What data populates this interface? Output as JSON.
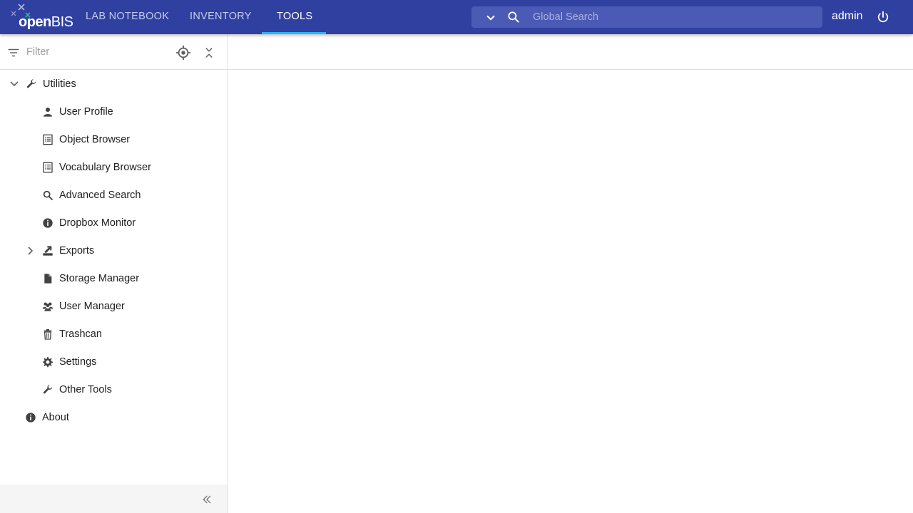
{
  "app": {
    "logo_text_light": "open",
    "logo_text_bold": "BIS"
  },
  "nav": {
    "tabs": [
      {
        "label": "LAB NOTEBOOK",
        "active": false
      },
      {
        "label": "INVENTORY",
        "active": false
      },
      {
        "label": "TOOLS",
        "active": true
      }
    ]
  },
  "search": {
    "placeholder": "Global Search",
    "value": ""
  },
  "user": {
    "name": "admin"
  },
  "sidebar": {
    "filter_placeholder": "Filter",
    "filter_value": "",
    "items": [
      {
        "label": "Utilities",
        "icon": "wrench-icon",
        "expanded": true,
        "level": 0
      },
      {
        "label": "User Profile",
        "icon": "person-icon",
        "level": 1
      },
      {
        "label": "Object Browser",
        "icon": "list-icon",
        "level": 1
      },
      {
        "label": "Vocabulary Browser",
        "icon": "list-icon",
        "level": 1
      },
      {
        "label": "Advanced Search",
        "icon": "search-icon",
        "level": 1
      },
      {
        "label": "Dropbox Monitor",
        "icon": "info-icon",
        "level": 1
      },
      {
        "label": "Exports",
        "icon": "export-icon",
        "expanded": false,
        "level": 1
      },
      {
        "label": "Storage Manager",
        "icon": "file-icon",
        "level": 1
      },
      {
        "label": "User Manager",
        "icon": "group-icon",
        "level": 1
      },
      {
        "label": "Trashcan",
        "icon": "trash-icon",
        "level": 1
      },
      {
        "label": "Settings",
        "icon": "gear-icon",
        "level": 1
      },
      {
        "label": "Other Tools",
        "icon": "wrench-icon",
        "level": 1
      },
      {
        "label": "About",
        "icon": "info-icon",
        "level": 0
      }
    ]
  },
  "colors": {
    "topbar": "#3040a0",
    "active_underline": "#29b6f6"
  }
}
